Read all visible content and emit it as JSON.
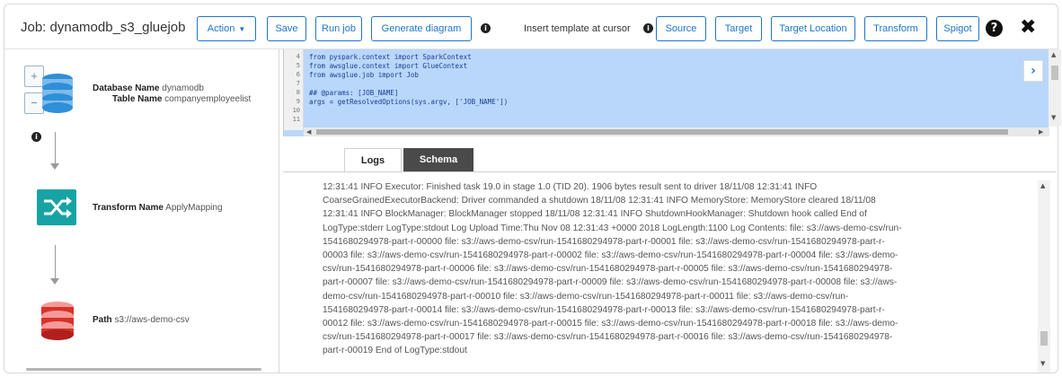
{
  "header": {
    "job_title": "Job: dynamodb_s3_gluejob",
    "action_label": "Action",
    "save_label": "Save",
    "run_job_label": "Run job",
    "generate_diagram_label": "Generate diagram",
    "insert_template_label": "Insert template at cursor",
    "source_label": "Source",
    "target_label": "Target",
    "target_location_label": "Target Location",
    "transform_label": "Transform",
    "spigot_label": "Spigot"
  },
  "diagram": {
    "zoom_in": "+",
    "zoom_out": "−",
    "source_node": {
      "db_key": "Database Name",
      "db_value": "dynamodb",
      "table_key": "Table Name",
      "table_value": "companyemployeelist"
    },
    "transform_node": {
      "key": "Transform Name",
      "value": "ApplyMapping"
    },
    "target_node": {
      "key": "Path",
      "value": "s3://aws-demo-csv"
    }
  },
  "editor": {
    "lines": [
      {
        "num": "4",
        "code": "from pyspark.context import SparkContext"
      },
      {
        "num": "5",
        "code": "from awsglue.context import GlueContext"
      },
      {
        "num": "6",
        "code": "from awsglue.job import Job"
      },
      {
        "num": "7",
        "code": ""
      },
      {
        "num": "8",
        "code": "## @params: [JOB_NAME]"
      },
      {
        "num": "9",
        "code": "args = getResolvedOptions(sys.argv, ['JOB_NAME'])"
      },
      {
        "num": "10",
        "code": ""
      },
      {
        "num": "11",
        "code": ""
      }
    ]
  },
  "tabs": {
    "logs": "Logs",
    "schema": "Schema"
  },
  "logs": {
    "lines": [
      "12:31:41 INFO Executor: Finished task 19.0 in stage 1.0 (TID 20). 1906 bytes result sent to driver 18/11/08 12:31:41 INFO",
      "CoarseGrainedExecutorBackend: Driver commanded a shutdown 18/11/08 12:31:41 INFO MemoryStore: MemoryStore cleared 18/11/08",
      "12:31:41 INFO BlockManager: BlockManager stopped 18/11/08 12:31:41 INFO ShutdownHookManager: Shutdown hook called End of",
      "LogType:stderr LogType:stdout Log Upload Time:Thu Nov 08 12:31:43 +0000 2018 LogLength:1100 Log Contents: file: s3://aws-demo-csv/run-",
      "1541680294978-part-r-00000 file: s3://aws-demo-csv/run-1541680294978-part-r-00001 file: s3://aws-demo-csv/run-1541680294978-part-r-",
      "00003 file: s3://aws-demo-csv/run-1541680294978-part-r-00002 file: s3://aws-demo-csv/run-1541680294978-part-r-00004 file: s3://aws-demo-",
      "csv/run-1541680294978-part-r-00006 file: s3://aws-demo-csv/run-1541680294978-part-r-00005 file: s3://aws-demo-csv/run-1541680294978-",
      "part-r-00007 file: s3://aws-demo-csv/run-1541680294978-part-r-00009 file: s3://aws-demo-csv/run-1541680294978-part-r-00008 file: s3://aws-",
      "demo-csv/run-1541680294978-part-r-00010 file: s3://aws-demo-csv/run-1541680294978-part-r-00011 file: s3://aws-demo-csv/run-",
      "1541680294978-part-r-00014 file: s3://aws-demo-csv/run-1541680294978-part-r-00013 file: s3://aws-demo-csv/run-1541680294978-part-r-",
      "00012 file: s3://aws-demo-csv/run-1541680294978-part-r-00015 file: s3://aws-demo-csv/run-1541680294978-part-r-00018 file: s3://aws-demo-",
      "csv/run-1541680294978-part-r-00017 file: s3://aws-demo-csv/run-1541680294978-part-r-00016 file: s3://aws-demo-csv/run-1541680294978-",
      "part-r-00019 End of LogType:stdout"
    ]
  },
  "colors": {
    "accent": "#1f75c9",
    "editor_selection": "#b9d7fb",
    "transform_teal": "#17a3a3",
    "database_blue": "#2f8fd8",
    "target_red": "#d9302c",
    "schema_tab_bg": "#4a4a4a"
  },
  "icons": {
    "source": "database-icon",
    "transform": "shuffle-icon",
    "target": "s3-bucket-icon",
    "help": "question-circle-icon",
    "close": "close-icon",
    "info": "info-icon",
    "expand": "expand-chevron-icon"
  }
}
